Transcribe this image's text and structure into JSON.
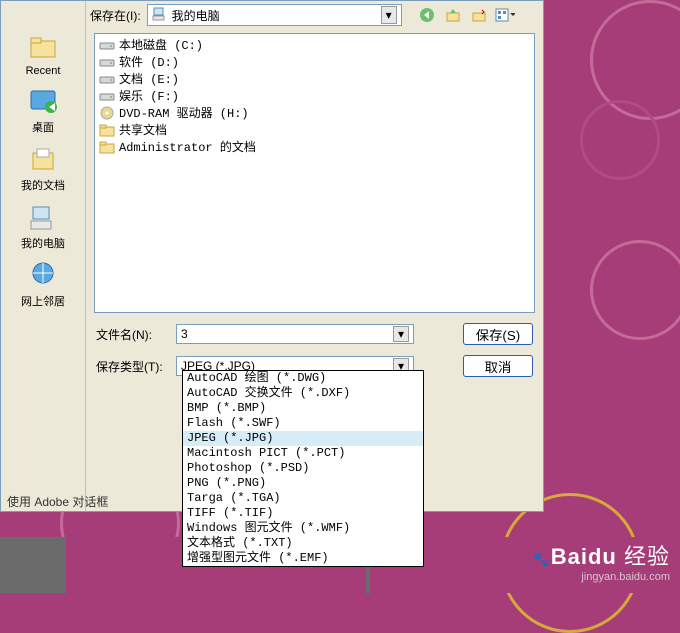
{
  "toolbar": {
    "save_in_label": "保存在(I):",
    "location": "我的电脑"
  },
  "sidebar": {
    "items": [
      {
        "label": "Recent"
      },
      {
        "label": "桌面"
      },
      {
        "label": "我的文档"
      },
      {
        "label": "我的电脑"
      },
      {
        "label": "网上邻居"
      }
    ]
  },
  "files": [
    {
      "icon": "drive",
      "name": "本地磁盘 (C:)"
    },
    {
      "icon": "drive",
      "name": "软件 (D:)"
    },
    {
      "icon": "drive",
      "name": "文档 (E:)"
    },
    {
      "icon": "drive",
      "name": "娱乐 (F:)"
    },
    {
      "icon": "dvd",
      "name": "DVD-RAM 驱动器 (H:)"
    },
    {
      "icon": "folder",
      "name": "共享文档"
    },
    {
      "icon": "folder",
      "name": "Administrator 的文档"
    }
  ],
  "form": {
    "filename_label": "文件名(N):",
    "filename_value": "3",
    "filetype_label": "保存类型(T):",
    "filetype_value": "JPEG (*.JPG)",
    "save_button": "保存(S)",
    "cancel_button": "取消"
  },
  "filetype_options": [
    "AutoCAD 绘图 (*.DWG)",
    "AutoCAD 交换文件 (*.DXF)",
    "BMP (*.BMP)",
    "Flash (*.SWF)",
    "JPEG (*.JPG)",
    "Macintosh PICT (*.PCT)",
    "Photoshop (*.PSD)",
    "PNG (*.PNG)",
    "Targa (*.TGA)",
    "TIFF (*.TIF)",
    "Windows 图元文件 (*.WMF)",
    "文本格式 (*.TXT)",
    "增强型图元文件 (*.EMF)"
  ],
  "filetype_selected_index": 4,
  "footer": {
    "text": "使用 Adobe 对话框"
  },
  "watermark": {
    "brand": "Baidu",
    "cn": "经验",
    "url": "jingyan.baidu.com"
  }
}
